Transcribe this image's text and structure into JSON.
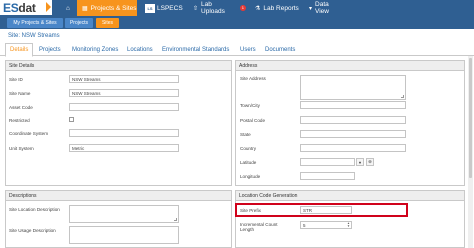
{
  "logo": {
    "text_a": "ES",
    "text_b": "dat"
  },
  "topnav": {
    "home_icon": "home-icon",
    "items": [
      {
        "label": "Projects & Sites",
        "icon": "building-icon"
      },
      {
        "label": "LSPECS",
        "icon": "lspecs-icon"
      },
      {
        "label": "Lab Uploads",
        "icon": "upload-icon",
        "badge": "1"
      },
      {
        "label": "Lab Reports",
        "icon": "flask-icon"
      },
      {
        "label": "Data View",
        "icon": "chevron-down-icon"
      }
    ]
  },
  "subnav": {
    "items": [
      "My Projects & Sites",
      "Projects",
      "Sites"
    ]
  },
  "site_title": "Site: NSW Streams",
  "tabs": [
    "Details",
    "Projects",
    "Monitoring Zones",
    "Locations",
    "Environmental Standards",
    "Users",
    "Documents"
  ],
  "site_details": {
    "heading": "Site Details",
    "site_id_label": "Site ID",
    "site_id_value": "NSW Streams",
    "site_name_label": "Site Name",
    "site_name_value": "NSW Streams",
    "asset_code_label": "Asset Code",
    "asset_code_value": "",
    "restricted_label": "Restricted",
    "coordinate_system_label": "Coordinate System",
    "coordinate_system_value": "",
    "unit_system_label": "Unit System",
    "unit_system_value": "Metric"
  },
  "address": {
    "heading": "Address",
    "site_address_label": "Site Address",
    "town_label": "Town/City",
    "postal_label": "Postal Code",
    "state_label": "State",
    "country_label": "Country",
    "latitude_label": "Latitude",
    "longitude_label": "Longitude",
    "pin_icon": "map-pin-icon",
    "target_icon": "crosshair-icon"
  },
  "descriptions": {
    "heading": "Descriptions",
    "location_desc_label": "Site Location Description",
    "usage_desc_label": "Site Usage Description"
  },
  "location_code": {
    "heading": "Location Code Generation",
    "prefix_label": "Site Prefix",
    "prefix_value": "STR",
    "increment_label": "Incremental Count Length",
    "increment_value": "5"
  },
  "colors": {
    "nav": "#2f5f92",
    "accent": "#f7941d",
    "link": "#2b6aa8",
    "highlight": "#d0021b"
  }
}
